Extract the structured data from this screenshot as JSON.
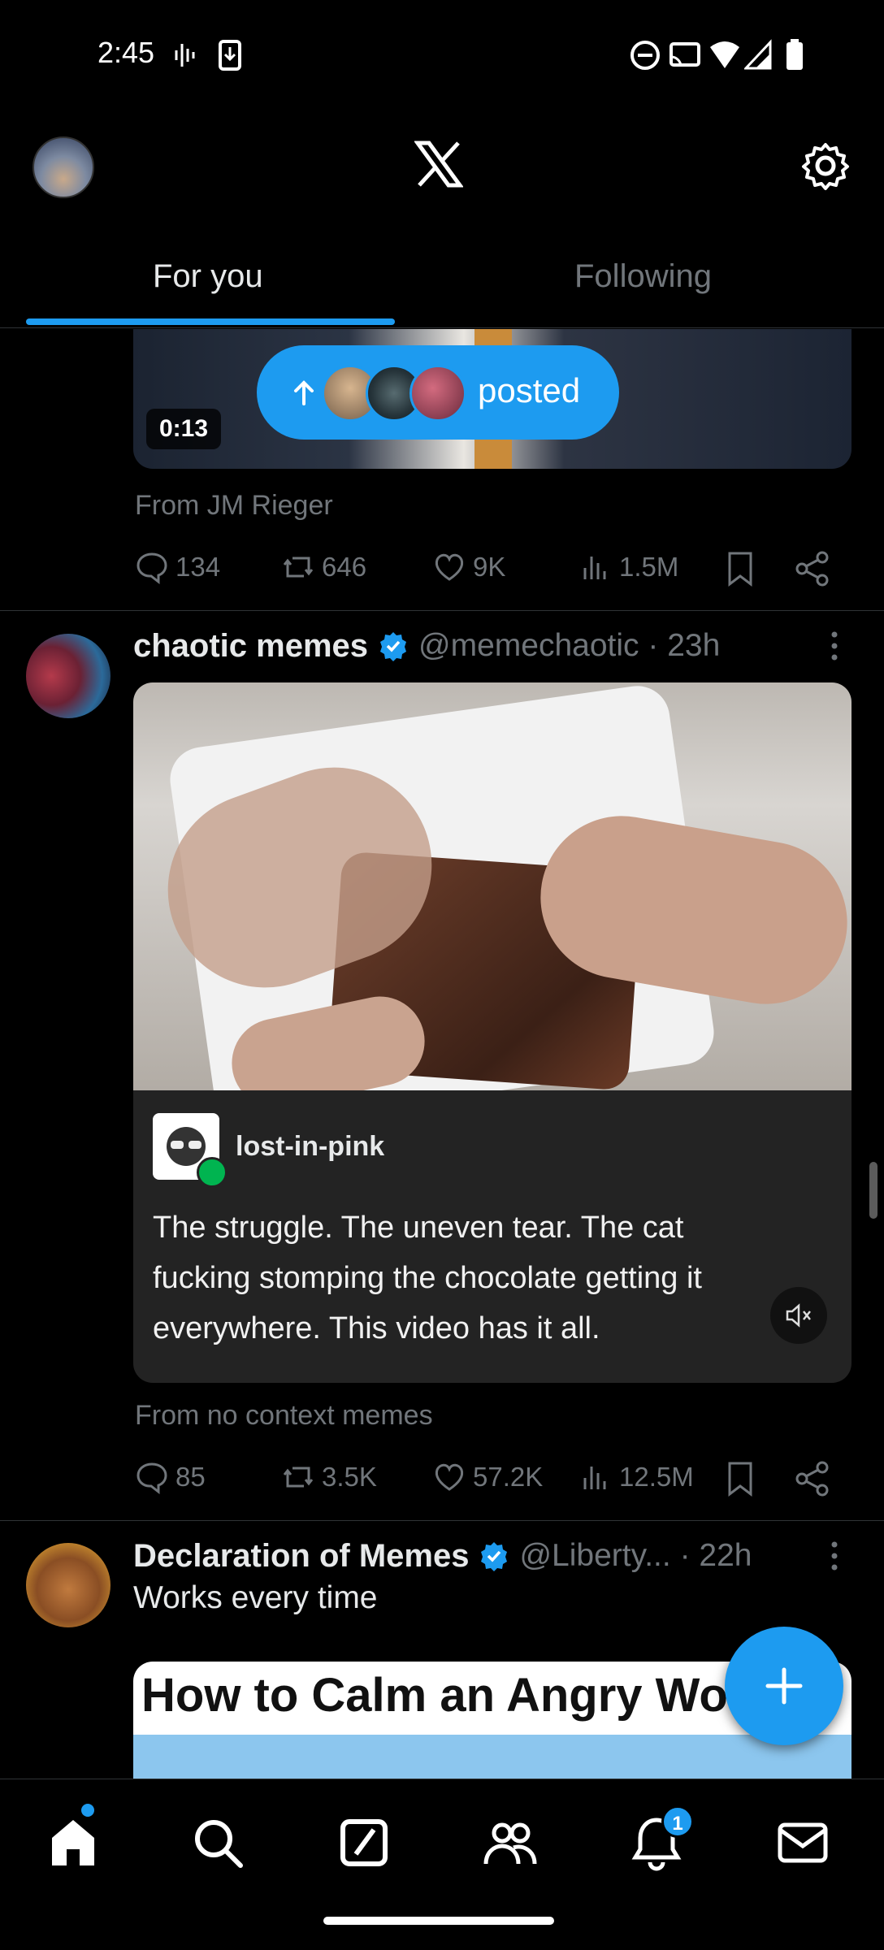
{
  "status_bar": {
    "time": "2:45"
  },
  "tabs": {
    "for_you": "For you",
    "following": "Following"
  },
  "pill": {
    "label": "posted"
  },
  "post1": {
    "duration": "0:13",
    "from": "From JM Rieger",
    "replies": "134",
    "reposts": "646",
    "likes": "9K",
    "views": "1.5M"
  },
  "post2": {
    "name": "chaotic memes",
    "handle": "@memechaotic · 23h",
    "tumblr_user": "lost-in-pink",
    "caption": "The struggle. The uneven tear. The cat fucking stomping the chocolate getting it everywhere. This video has it all.",
    "from": "From no context memes",
    "replies": "85",
    "reposts": "3.5K",
    "likes": "57.2K",
    "views": "12.5M"
  },
  "post3": {
    "name": "Declaration of Memes",
    "handle": "@Liberty... · 22h",
    "text": "Works every time",
    "image_text": "How to Calm an Angry Wo"
  },
  "nav": {
    "notifications_badge": "1"
  },
  "colors": {
    "accent": "#1d9bf0",
    "background": "#000000",
    "muted": "#71767b",
    "verified": "#1d9bf0"
  },
  "icons": [
    "wifi-icon",
    "signal-icon",
    "battery-icon",
    "gear-icon",
    "x-logo-icon",
    "reply-icon",
    "repost-icon",
    "like-icon",
    "views-icon",
    "bookmark-icon",
    "share-icon",
    "verified-icon",
    "mute-icon",
    "plus-icon",
    "home-icon",
    "search-icon",
    "grok-icon",
    "communities-icon",
    "bell-icon",
    "mail-icon"
  ]
}
